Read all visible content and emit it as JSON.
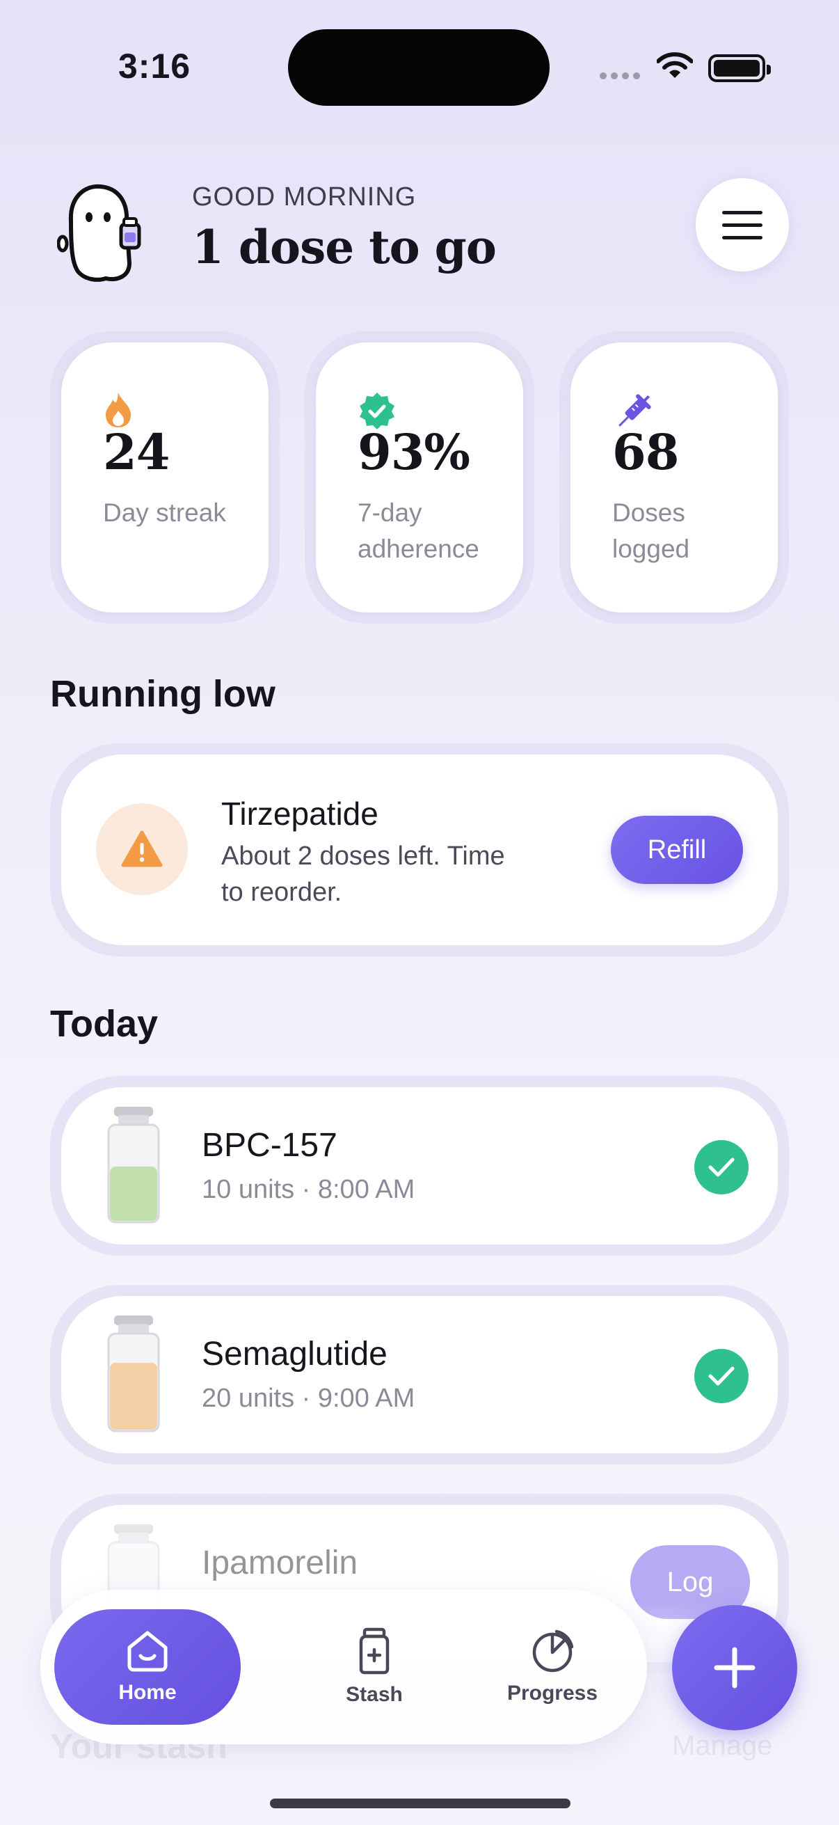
{
  "status_bar": {
    "time": "3:16"
  },
  "header": {
    "greeting": "GOOD MORNING",
    "headline": "1 dose to go"
  },
  "stats": [
    {
      "icon": "flame-icon",
      "value": "24",
      "label": "Day streak",
      "color": "#f08a3c"
    },
    {
      "icon": "verified-badge-icon",
      "value": "93%",
      "label": "7-day adherence",
      "color": "#2ec08e"
    },
    {
      "icon": "syringe-icon",
      "value": "68",
      "label": "Doses logged",
      "color": "#6a55e3"
    }
  ],
  "running_low": {
    "title": "Running low",
    "item_name": "Tirzepatide",
    "description": "About 2 doses left. Time to reorder.",
    "button_label": "Refill"
  },
  "today": {
    "title": "Today",
    "items": [
      {
        "name": "BPC-157",
        "detail": "10 units · 8:00 AM",
        "status": "done",
        "liquid_color": "#c2e0ae"
      },
      {
        "name": "Semaglutide",
        "detail": "20 units · 9:00 AM",
        "status": "done",
        "liquid_color": "#f4cfa6"
      },
      {
        "name": "Ipamorelin",
        "detail": "",
        "status": "pending",
        "action_label": "Log",
        "liquid_color": "#e8e6ee"
      }
    ]
  },
  "stash": {
    "title": "Your stash",
    "action": "Manage"
  },
  "tabbar": {
    "tabs": [
      {
        "label": "Home",
        "icon": "home-icon",
        "active": true
      },
      {
        "label": "Stash",
        "icon": "vial-icon",
        "active": false
      },
      {
        "label": "Progress",
        "icon": "pie-chart-icon",
        "active": false
      }
    ],
    "fab_icon": "plus-icon"
  },
  "colors": {
    "accent": "#6a55e3",
    "success": "#2ec08e",
    "warning": "#f08a3c"
  }
}
